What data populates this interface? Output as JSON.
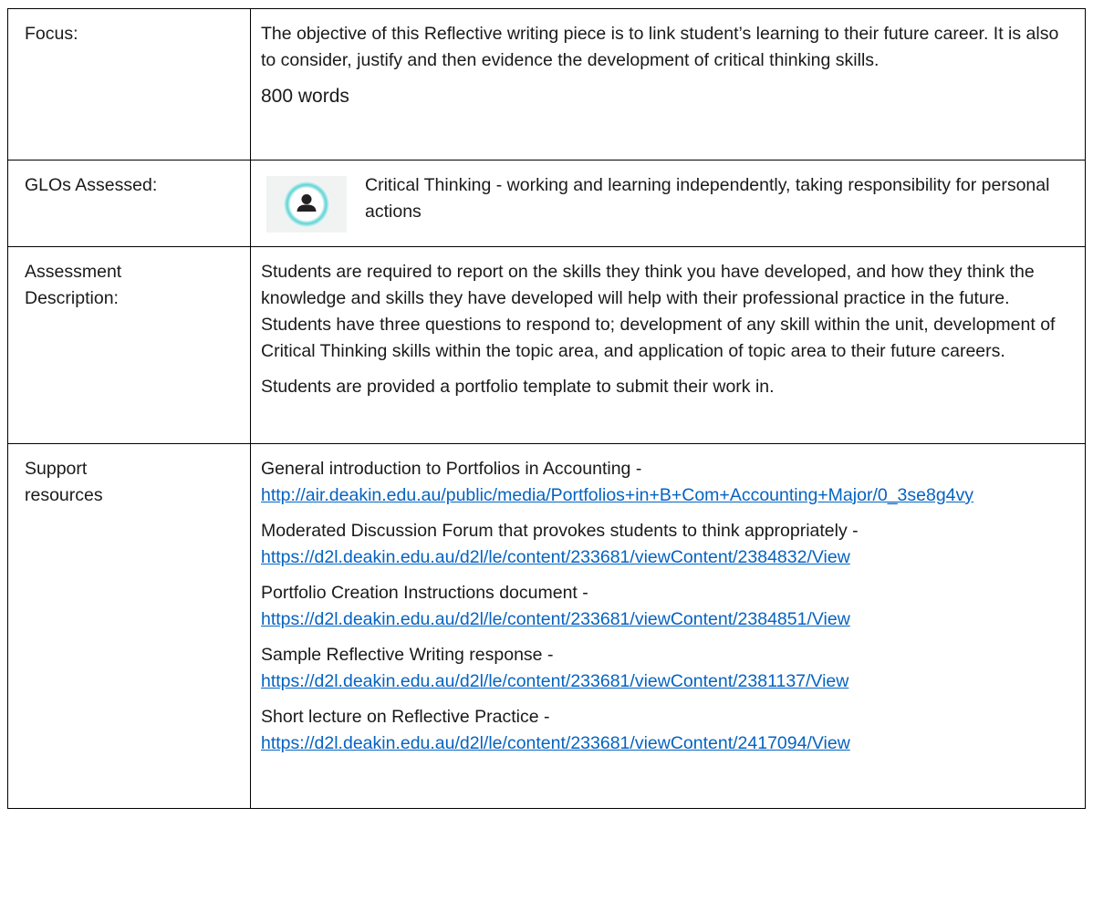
{
  "rows": {
    "focus": {
      "label": "Focus:",
      "text": "The objective of this Reflective writing piece is to link student’s learning to their future career.  It is also to consider, justify and then evidence the development of critical thinking skills.",
      "words": "800 words"
    },
    "glos": {
      "label": "GLOs Assessed:",
      "icon": "person-badge-icon",
      "text": "Critical Thinking - working and learning independently, taking responsibility for personal actions"
    },
    "assessment": {
      "label_line1": "Assessment",
      "label_line2": "Description:",
      "text": "Students are required to report on the skills they think you have developed, and how they think the knowledge and skills they have developed will help with their professional practice in the future. Students have three questions to respond to; development of any skill within the unit, development of Critical Thinking skills within the topic area, and application of topic area to their future careers.",
      "note": "Students are provided a portfolio template to submit their work in."
    },
    "support": {
      "label_line1": "Support",
      "label_line2": "resources",
      "items": [
        {
          "title": "General introduction to Portfolios in Accounting -",
          "url": "http://air.deakin.edu.au/public/media/Portfolios+in+B+Com+Accounting+Major/0_3se8g4vy"
        },
        {
          "title": "Moderated Discussion Forum that provokes students to think appropriately -",
          "url": "https://d2l.deakin.edu.au/d2l/le/content/233681/viewContent/2384832/View"
        },
        {
          "title": "Portfolio Creation Instructions document -",
          "url": "https://d2l.deakin.edu.au/d2l/le/content/233681/viewContent/2384851/View"
        },
        {
          "title": "Sample Reflective Writing response -",
          "url": "https://d2l.deakin.edu.au/d2l/le/content/233681/viewContent/2381137/View"
        },
        {
          "title": "Short lecture on Reflective Practice -",
          "url": "https://d2l.deakin.edu.au/d2l/le/content/233681/viewContent/2417094/View"
        }
      ]
    }
  },
  "colors": {
    "link": "#0563c1",
    "icon_ring": "#5ed3d3",
    "icon_fill": "#222222"
  }
}
